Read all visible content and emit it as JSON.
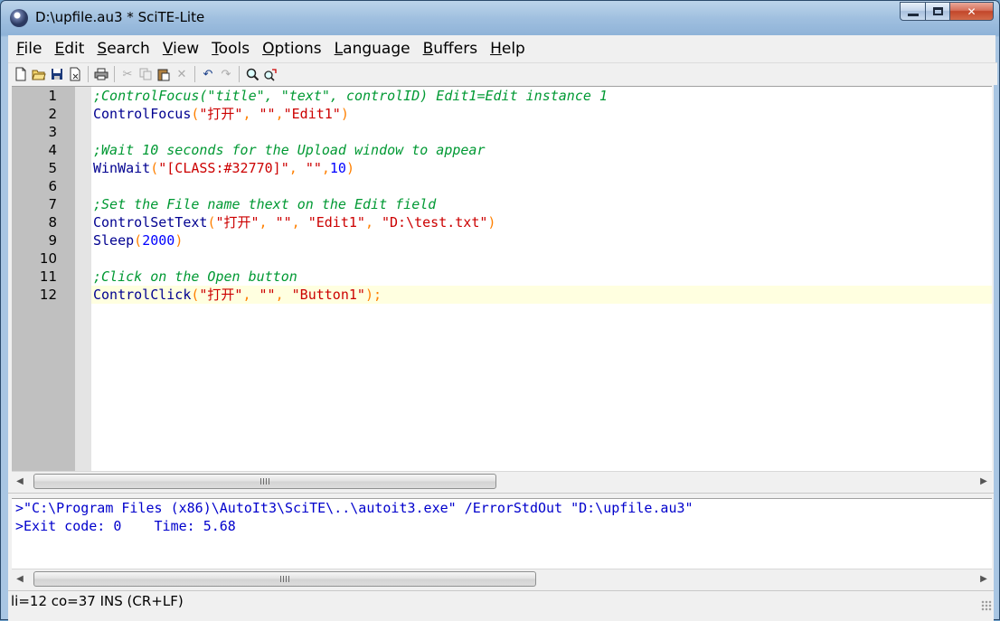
{
  "window": {
    "title": "D:\\upfile.au3 * SciTE-Lite"
  },
  "menu": [
    {
      "underline": "F",
      "rest": "ile"
    },
    {
      "underline": "E",
      "rest": "dit"
    },
    {
      "underline": "S",
      "rest": "earch"
    },
    {
      "underline": "V",
      "rest": "iew"
    },
    {
      "underline": "T",
      "rest": "ools"
    },
    {
      "underline": "O",
      "rest": "ptions"
    },
    {
      "underline": "L",
      "rest": "anguage"
    },
    {
      "underline": "B",
      "rest": "uffers"
    },
    {
      "underline": "H",
      "rest": "elp"
    }
  ],
  "toolbar_icons": [
    "new-file-icon",
    "open-folder-icon",
    "save-icon",
    "close-file-icon",
    "print-icon",
    "cut-icon",
    "copy-icon",
    "paste-icon",
    "delete-icon",
    "undo-icon",
    "redo-icon",
    "find-icon",
    "replace-icon"
  ],
  "editor": {
    "line_numbers": [
      "1",
      "2",
      "3",
      "4",
      "5",
      "6",
      "7",
      "8",
      "9",
      "10",
      "11",
      "12"
    ],
    "lines": [
      [
        {
          "t": ";ControlFocus(\"title\", \"text\", controlID) Edit1=Edit instance 1",
          "c": "com"
        }
      ],
      [
        {
          "t": "ControlFocus",
          "c": "fn"
        },
        {
          "t": "(",
          "c": "op"
        },
        {
          "t": "\"打开\"",
          "c": "str"
        },
        {
          "t": ", ",
          "c": "op"
        },
        {
          "t": "\"\"",
          "c": "str"
        },
        {
          "t": ",",
          "c": "op"
        },
        {
          "t": "\"Edit1\"",
          "c": "str"
        },
        {
          "t": ")",
          "c": "op"
        }
      ],
      [],
      [
        {
          "t": ";Wait 10 seconds for the Upload window to appear",
          "c": "com"
        }
      ],
      [
        {
          "t": "WinWait",
          "c": "fn"
        },
        {
          "t": "(",
          "c": "op"
        },
        {
          "t": "\"[CLASS:#32770]\"",
          "c": "str"
        },
        {
          "t": ", ",
          "c": "op"
        },
        {
          "t": "\"\"",
          "c": "str"
        },
        {
          "t": ",",
          "c": "op"
        },
        {
          "t": "10",
          "c": "num"
        },
        {
          "t": ")",
          "c": "op"
        }
      ],
      [],
      [
        {
          "t": ";Set the File name thext on the Edit field",
          "c": "com"
        }
      ],
      [
        {
          "t": "ControlSetText",
          "c": "fn"
        },
        {
          "t": "(",
          "c": "op"
        },
        {
          "t": "\"打开\"",
          "c": "str"
        },
        {
          "t": ", ",
          "c": "op"
        },
        {
          "t": "\"\"",
          "c": "str"
        },
        {
          "t": ", ",
          "c": "op"
        },
        {
          "t": "\"Edit1\"",
          "c": "str"
        },
        {
          "t": ", ",
          "c": "op"
        },
        {
          "t": "\"D:\\test.txt\"",
          "c": "str"
        },
        {
          "t": ")",
          "c": "op"
        }
      ],
      [
        {
          "t": "Sleep",
          "c": "fn"
        },
        {
          "t": "(",
          "c": "op"
        },
        {
          "t": "2000",
          "c": "num"
        },
        {
          "t": ")",
          "c": "op"
        }
      ],
      [],
      [
        {
          "t": ";Click on the Open button",
          "c": "com"
        }
      ],
      [
        {
          "t": "ControlClick",
          "c": "fn"
        },
        {
          "t": "(",
          "c": "op"
        },
        {
          "t": "\"打开\"",
          "c": "str"
        },
        {
          "t": ", ",
          "c": "op"
        },
        {
          "t": "\"\"",
          "c": "str"
        },
        {
          "t": ", ",
          "c": "op"
        },
        {
          "t": "\"Button1\"",
          "c": "str"
        },
        {
          "t": ");",
          "c": "op"
        }
      ]
    ],
    "current_line": 12
  },
  "output": {
    "lines": [
      ">\"C:\\Program Files (x86)\\AutoIt3\\SciTE\\..\\autoit3.exe\" /ErrorStdOut \"D:\\upfile.au3\"",
      ">Exit code: 0    Time: 5.68"
    ]
  },
  "status": {
    "text": "li=12 co=37 INS (CR+LF)"
  }
}
